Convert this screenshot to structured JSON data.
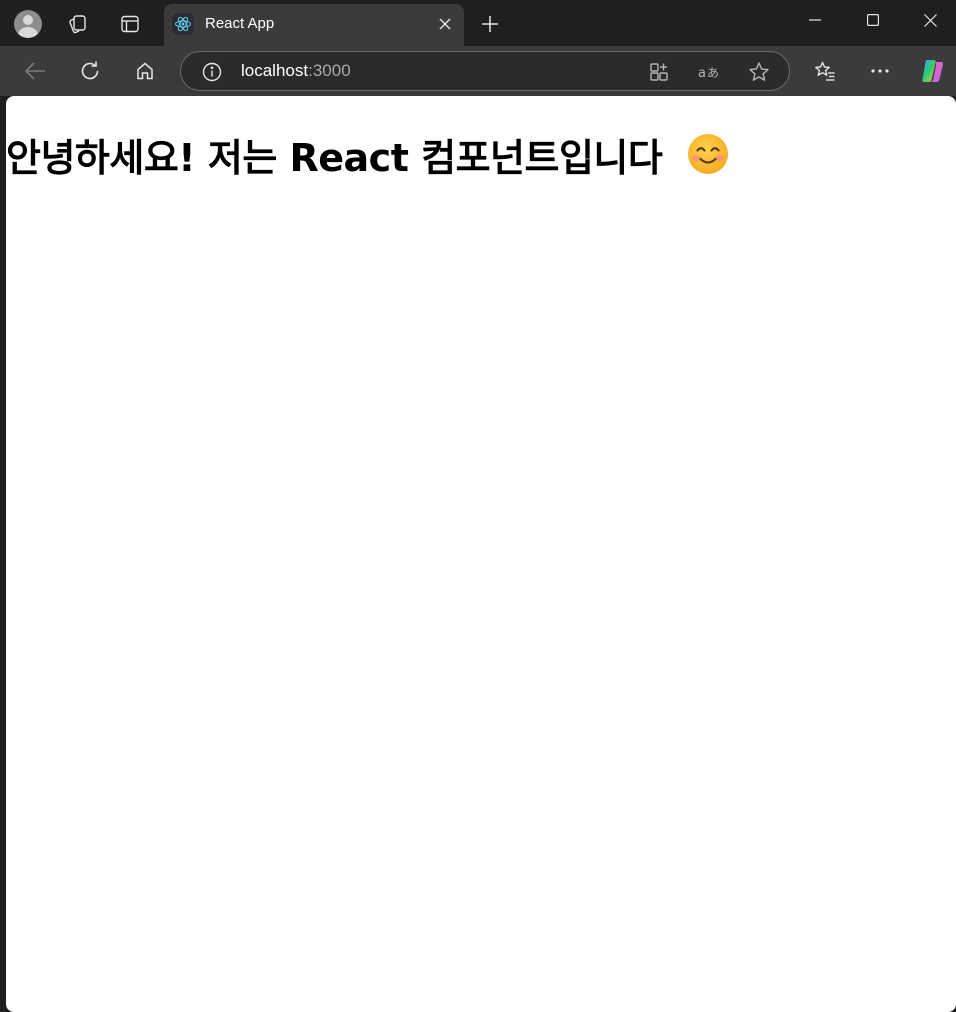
{
  "browser": {
    "tab": {
      "title": "React App",
      "favicon": "react-logo-icon"
    },
    "address": {
      "host": "localhost",
      "port": ":3000"
    },
    "colors": {
      "chrome_bg": "#1f1f1f",
      "toolbar_bg": "#3b3b3b",
      "page_bg": "#ffffff"
    }
  },
  "page": {
    "heading": "안녕하세요! 저는 React 컴포넌트입니다",
    "emoji": "smiling-face-icon"
  }
}
